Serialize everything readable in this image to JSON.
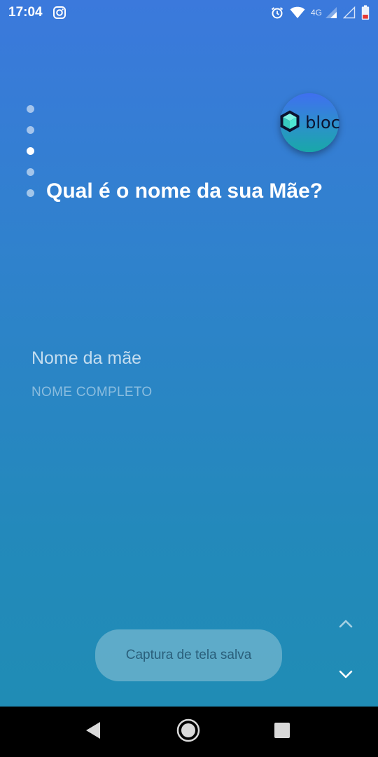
{
  "status_bar": {
    "time": "17:04",
    "network_label": "4G",
    "icons": [
      "instagram-icon",
      "alarm-icon",
      "wifi-icon",
      "signal-icon",
      "signal-empty-icon",
      "battery-low-icon"
    ]
  },
  "progress": {
    "total_steps": 5,
    "current_step": 3
  },
  "logo": {
    "text": "bloc",
    "icon": "cube-icon"
  },
  "question": {
    "title": "Qual é o nome da sua Mãe?"
  },
  "form": {
    "label": "Nome da mãe",
    "input_value": "",
    "input_placeholder": "NOME COMPLETO"
  },
  "navigation": {
    "up_icon": "chevron-up-icon",
    "down_icon": "chevron-down-icon"
  },
  "toast": {
    "message": "Captura de tela salva"
  },
  "system_nav": {
    "icons": [
      "back-icon",
      "home-icon",
      "recents-icon"
    ]
  },
  "colors": {
    "background_top": "#3b79dc",
    "background_bottom": "#1f8db3",
    "logo_gradient_top": "#3f6ff0",
    "logo_gradient_bottom": "#18a8a8",
    "cube_accent": "#4ee6d3"
  }
}
